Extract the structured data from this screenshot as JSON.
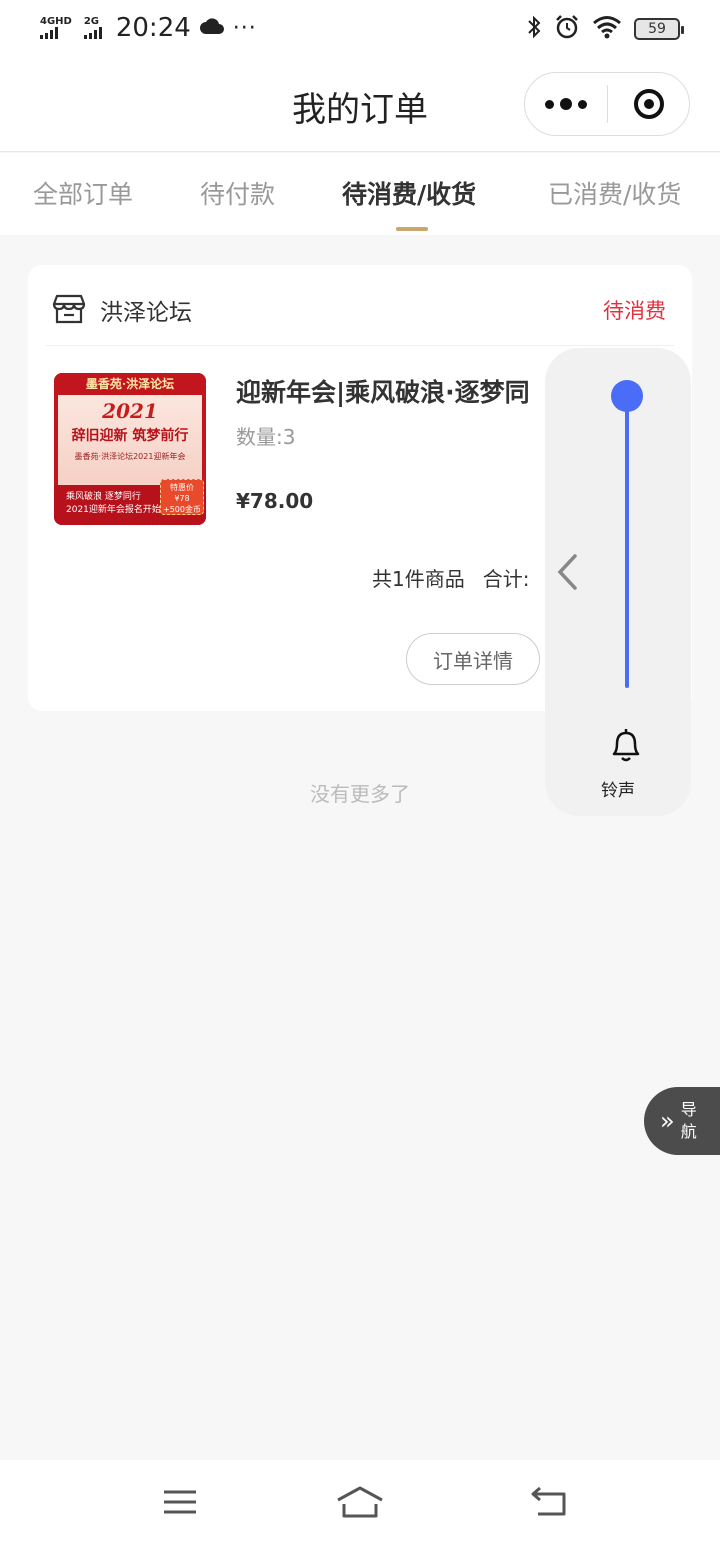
{
  "status_bar": {
    "signal1_label": "4GHD",
    "signal2_label": "2G",
    "time": "20:24",
    "more": "···",
    "battery": "59"
  },
  "header": {
    "title": "我的订单"
  },
  "tabs": [
    {
      "label": "全部订单",
      "active": false
    },
    {
      "label": "待付款",
      "active": false
    },
    {
      "label": "待消费/收货",
      "active": true
    },
    {
      "label": "已消费/收货",
      "active": false
    }
  ],
  "order": {
    "shop_name": "洪泽论坛",
    "status": "待消费",
    "product": {
      "title": "迎新年会|乘风破浪·逐梦同",
      "quantity": "数量:3",
      "price": "¥78.00",
      "image": {
        "banner": "墨香苑·洪泽论坛",
        "year": "2021",
        "slogan": "辞旧迎新 筑梦前行",
        "subtitle": "墨香苑·洪泽论坛2021迎新年会",
        "bottom_line1": "乘风破浪 逐梦同行",
        "bottom_line2": "2021迎新年会报名开始",
        "tag_line1": "特惠价",
        "tag_line2": "¥78",
        "tag_line3": "+500金币"
      }
    },
    "summary_count": "共1件商品",
    "summary_total_label": "合计:",
    "detail_button": "订单详情"
  },
  "footer_text": "没有更多了",
  "volume_overlay": {
    "level": 1.0,
    "label": "铃声",
    "accent": "#4a6cf7"
  },
  "float_nav": {
    "label_line1": "导",
    "label_line2": "航",
    "arrows": "»"
  },
  "colors": {
    "status_red": "#e0313f",
    "tab_underline": "#c9a66b"
  }
}
